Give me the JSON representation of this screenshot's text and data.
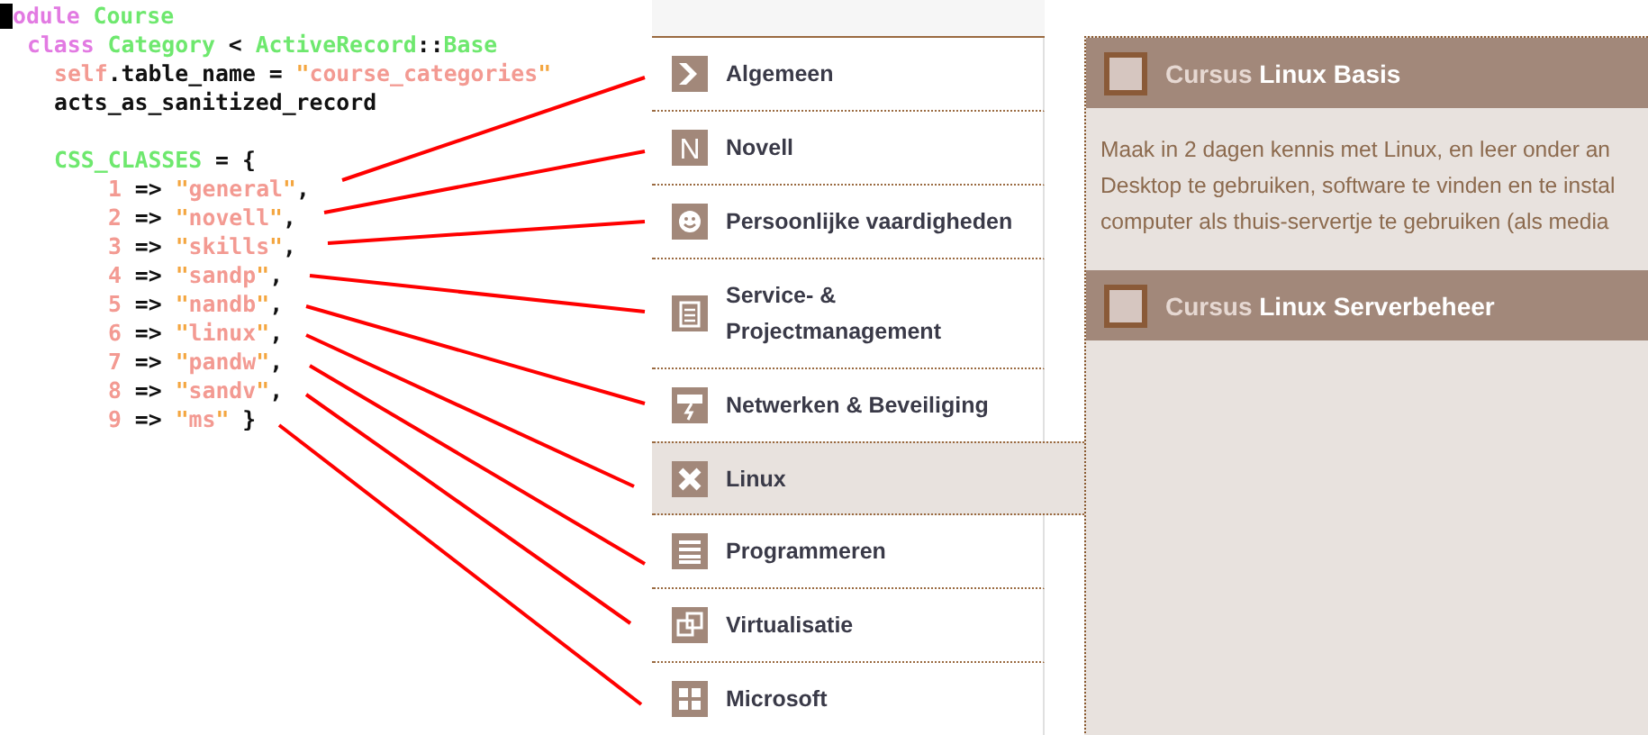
{
  "code": {
    "lines": [
      {
        "kind": "module",
        "cursor": true,
        "tokens": [
          {
            "kind": "keyword",
            "text": "odule "
          },
          {
            "kind": "constant",
            "text": "Course"
          }
        ]
      },
      {
        "kind": "class",
        "tokens": [
          {
            "kind": "keyword",
            "text": "class "
          },
          {
            "kind": "constant",
            "text": "Category"
          },
          {
            "kind": "plain",
            "text": " < "
          },
          {
            "kind": "constant",
            "text": "ActiveRecord"
          },
          {
            "kind": "plain",
            "text": "::"
          },
          {
            "kind": "constant",
            "text": "Base"
          }
        ]
      },
      {
        "kind": "body",
        "tokens": [
          {
            "kind": "self",
            "text": "self"
          },
          {
            "kind": "plain",
            "text": ".table_name = "
          },
          {
            "kind": "quote",
            "text": "\""
          },
          {
            "kind": "string",
            "text": "course_categories"
          },
          {
            "kind": "quote",
            "text": "\""
          }
        ]
      },
      {
        "kind": "body",
        "tokens": [
          {
            "kind": "plain",
            "text": "acts_as_sanitized_record"
          }
        ]
      },
      {
        "kind": "block",
        "tokens": [
          {
            "kind": "constant",
            "text": "CSS_CLASSES"
          },
          {
            "kind": "plain",
            "text": " = {"
          }
        ]
      },
      {
        "kind": "entry",
        "tokens": [
          {
            "kind": "number",
            "text": "1"
          },
          {
            "kind": "plain",
            "text": " => "
          },
          {
            "kind": "quote",
            "text": "\""
          },
          {
            "kind": "string",
            "text": "general"
          },
          {
            "kind": "quote",
            "text": "\""
          },
          {
            "kind": "plain",
            "text": ","
          }
        ]
      },
      {
        "kind": "entry",
        "tokens": [
          {
            "kind": "number",
            "text": "2"
          },
          {
            "kind": "plain",
            "text": " => "
          },
          {
            "kind": "quote",
            "text": "\""
          },
          {
            "kind": "string",
            "text": "novell"
          },
          {
            "kind": "quote",
            "text": "\""
          },
          {
            "kind": "plain",
            "text": ","
          }
        ]
      },
      {
        "kind": "entry",
        "tokens": [
          {
            "kind": "number",
            "text": "3"
          },
          {
            "kind": "plain",
            "text": " => "
          },
          {
            "kind": "quote",
            "text": "\""
          },
          {
            "kind": "string",
            "text": "skills"
          },
          {
            "kind": "quote",
            "text": "\""
          },
          {
            "kind": "plain",
            "text": ","
          }
        ]
      },
      {
        "kind": "entry",
        "tokens": [
          {
            "kind": "number",
            "text": "4"
          },
          {
            "kind": "plain",
            "text": " => "
          },
          {
            "kind": "quote",
            "text": "\""
          },
          {
            "kind": "string",
            "text": "sandp"
          },
          {
            "kind": "quote",
            "text": "\""
          },
          {
            "kind": "plain",
            "text": ","
          }
        ]
      },
      {
        "kind": "entry",
        "tokens": [
          {
            "kind": "number",
            "text": "5"
          },
          {
            "kind": "plain",
            "text": " => "
          },
          {
            "kind": "quote",
            "text": "\""
          },
          {
            "kind": "string",
            "text": "nandb"
          },
          {
            "kind": "quote",
            "text": "\""
          },
          {
            "kind": "plain",
            "text": ","
          }
        ]
      },
      {
        "kind": "entry",
        "tokens": [
          {
            "kind": "number",
            "text": "6"
          },
          {
            "kind": "plain",
            "text": " => "
          },
          {
            "kind": "quote",
            "text": "\""
          },
          {
            "kind": "string",
            "text": "linux"
          },
          {
            "kind": "quote",
            "text": "\""
          },
          {
            "kind": "plain",
            "text": ","
          }
        ]
      },
      {
        "kind": "entry",
        "tokens": [
          {
            "kind": "number",
            "text": "7"
          },
          {
            "kind": "plain",
            "text": " => "
          },
          {
            "kind": "quote",
            "text": "\""
          },
          {
            "kind": "string",
            "text": "pandw"
          },
          {
            "kind": "quote",
            "text": "\""
          },
          {
            "kind": "plain",
            "text": ","
          }
        ]
      },
      {
        "kind": "entry",
        "tokens": [
          {
            "kind": "number",
            "text": "8"
          },
          {
            "kind": "plain",
            "text": " => "
          },
          {
            "kind": "quote",
            "text": "\""
          },
          {
            "kind": "string",
            "text": "sandv"
          },
          {
            "kind": "quote",
            "text": "\""
          },
          {
            "kind": "plain",
            "text": ","
          }
        ]
      },
      {
        "kind": "entry",
        "tokens": [
          {
            "kind": "number",
            "text": "9"
          },
          {
            "kind": "plain",
            "text": " => "
          },
          {
            "kind": "quote",
            "text": "\""
          },
          {
            "kind": "string",
            "text": "ms"
          },
          {
            "kind": "quote",
            "text": "\""
          },
          {
            "kind": "plain",
            "text": " }"
          }
        ]
      }
    ]
  },
  "menu": {
    "items": [
      {
        "label": "Algemeen",
        "kind": "chevron",
        "selected": false
      },
      {
        "label": "Novell",
        "kind": "letter",
        "glyph": "N",
        "selected": false
      },
      {
        "label": "Persoonlijke vaardigheden",
        "kind": "smiley",
        "selected": false
      },
      {
        "label": "Service- & Projectmanagement",
        "kind": "clipboard",
        "selected": false
      },
      {
        "label": "Netwerken & Beveiliging",
        "kind": "sign",
        "selected": false
      },
      {
        "label": "Linux",
        "kind": "cross",
        "selected": true
      },
      {
        "label": "Programmeren",
        "kind": "stack",
        "selected": false
      },
      {
        "label": "Virtualisatie",
        "kind": "squares",
        "selected": false
      },
      {
        "label": "Microsoft",
        "kind": "windows",
        "selected": false
      }
    ]
  },
  "courses": [
    {
      "prefix": "Cursus",
      "name": "Linux Basis",
      "checked": false,
      "description": [
        "Maak in 2 dagen kennis met Linux, en leer onder an",
        "Desktop te gebruiken, software te vinden en te instal",
        "computer als thuis-servertje te gebruiken (als media"
      ]
    },
    {
      "prefix": "Cursus",
      "name": "Linux Serverbeheer",
      "checked": false
    }
  ]
}
